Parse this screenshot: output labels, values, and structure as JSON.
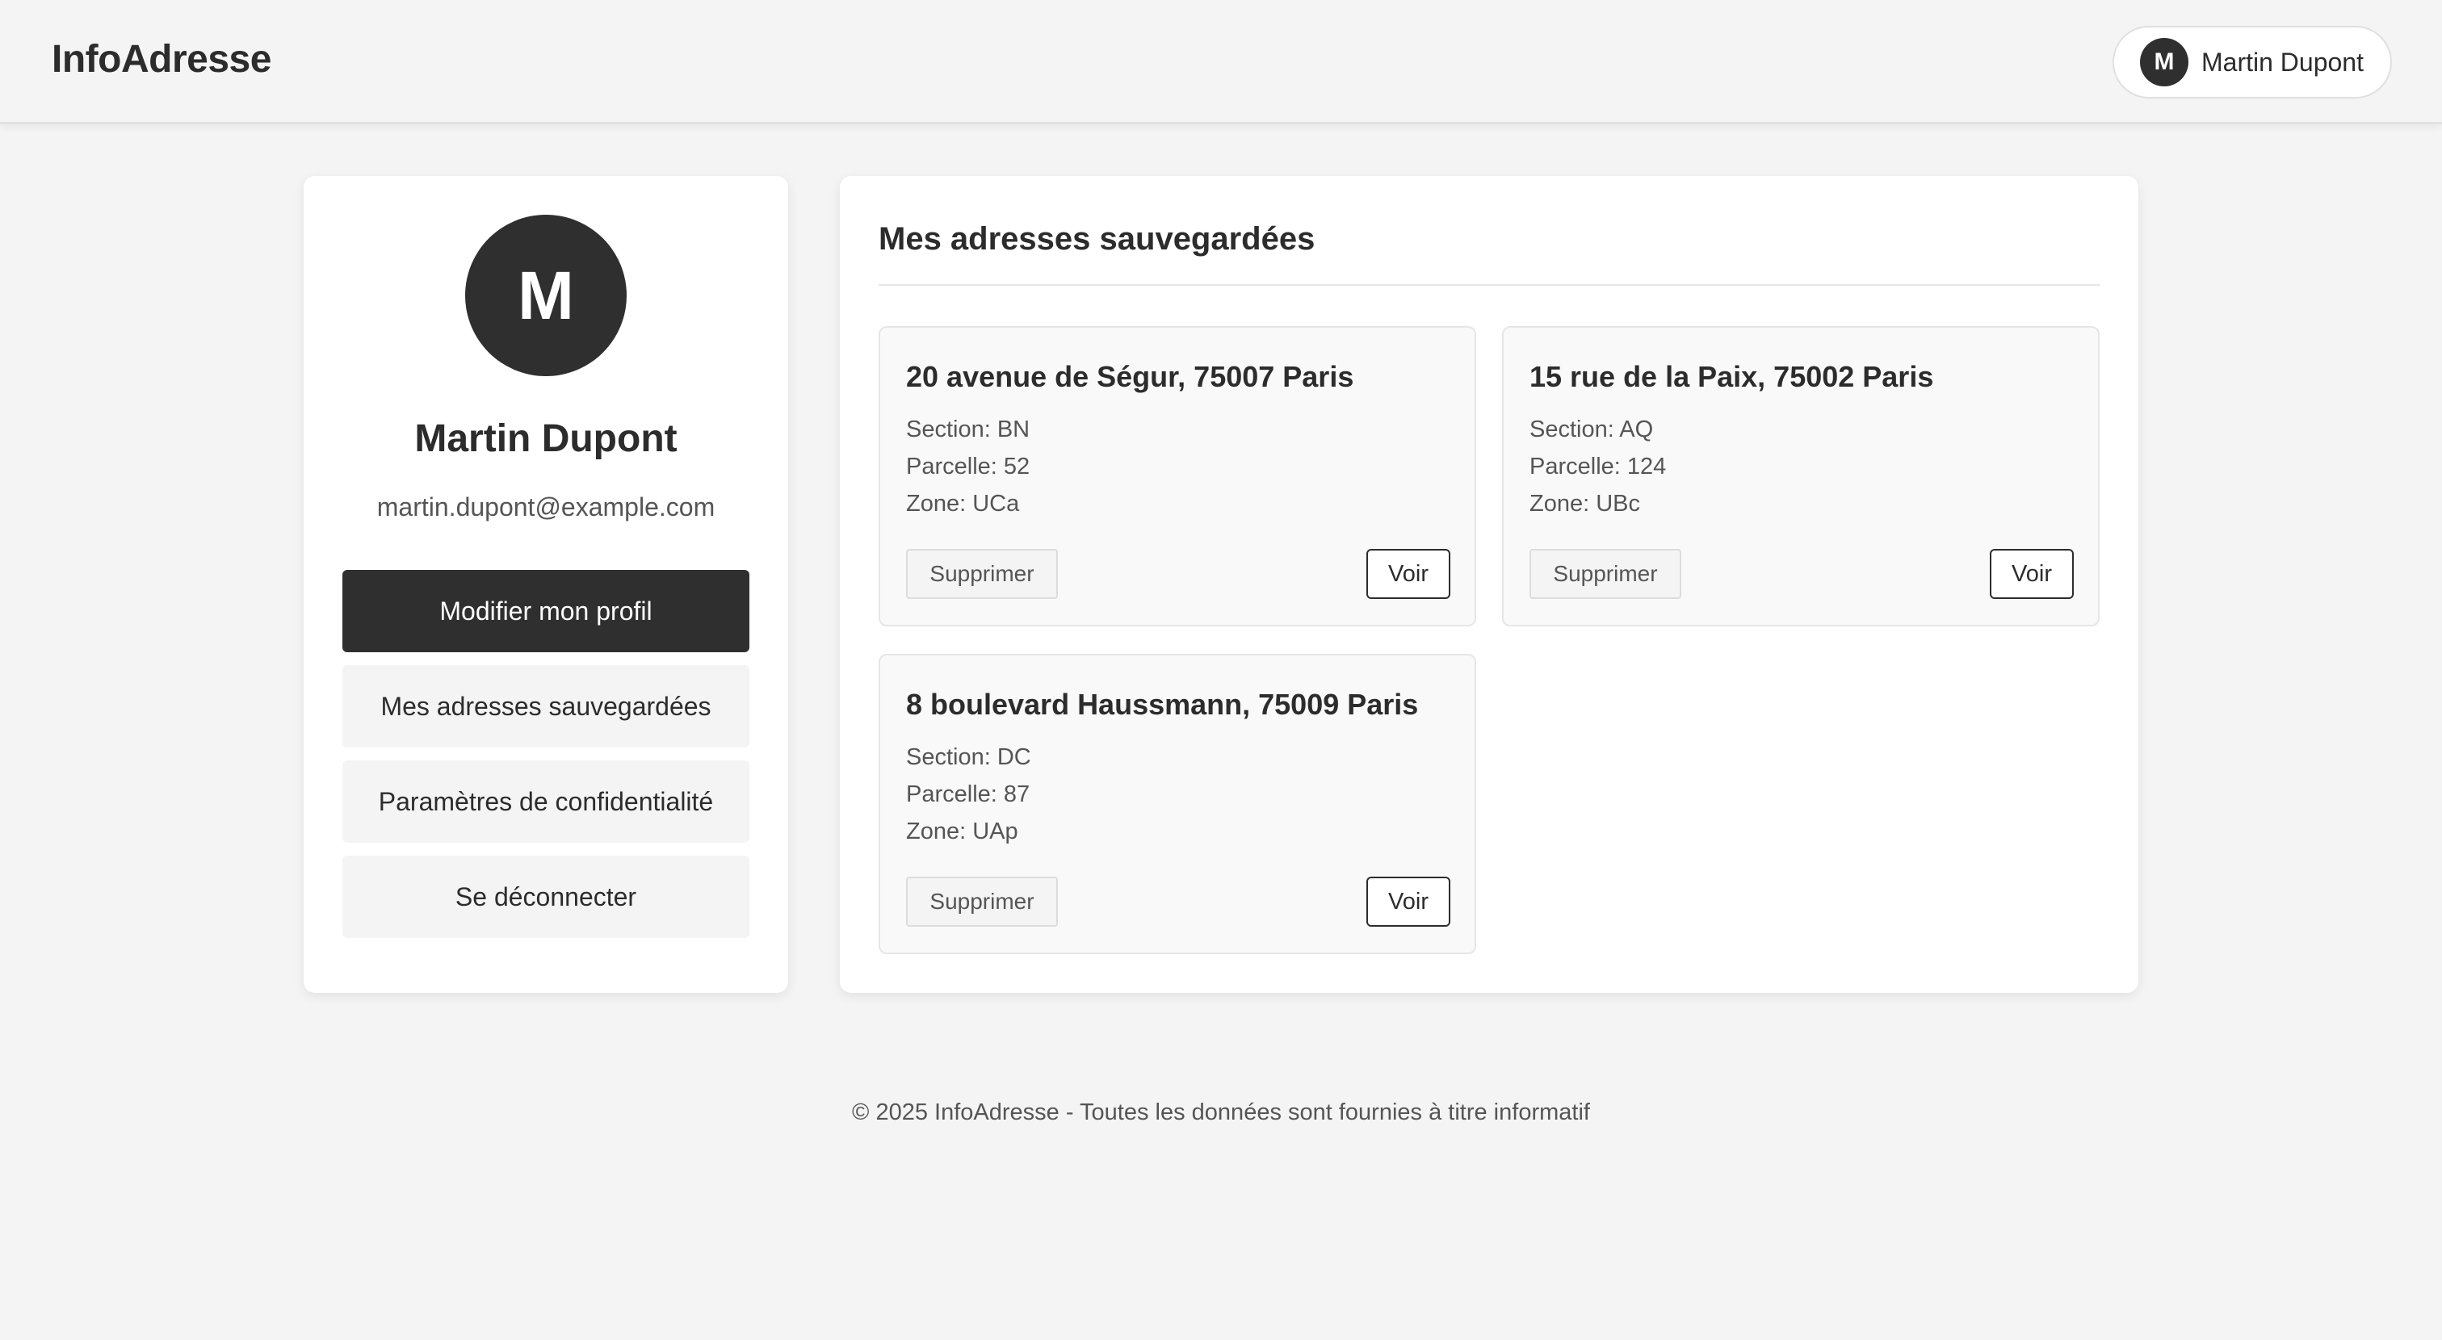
{
  "header": {
    "brand": "InfoAdresse",
    "user_chip": {
      "initial": "M",
      "name": "Martin Dupont"
    }
  },
  "profile": {
    "initial": "M",
    "name": "Martin Dupont",
    "email": "martin.dupont@example.com",
    "menu": [
      {
        "label": "Modifier mon profil"
      },
      {
        "label": "Mes adresses sauvegardées"
      },
      {
        "label": "Paramètres de confidentialité"
      },
      {
        "label": "Se déconnecter"
      }
    ]
  },
  "saved": {
    "title": "Mes adresses sauvegardées",
    "addresses": [
      {
        "title": "20 avenue de Ségur, 75007 Paris",
        "section": "Section: BN",
        "parcel": "Parcelle: 52",
        "zone": "Zone: UCa",
        "delete_label": "Supprimer",
        "view_label": "Voir"
      },
      {
        "title": "15 rue de la Paix, 75002 Paris",
        "section": "Section: AQ",
        "parcel": "Parcelle: 124",
        "zone": "Zone: UBc",
        "delete_label": "Supprimer",
        "view_label": "Voir"
      },
      {
        "title": "8 boulevard Haussmann, 75009 Paris",
        "section": "Section: DC",
        "parcel": "Parcelle: 87",
        "zone": "Zone: UAp",
        "delete_label": "Supprimer",
        "view_label": "Voir"
      }
    ]
  },
  "footer": {
    "text": "© 2025 InfoAdresse - Toutes les données sont fournies à titre informatif"
  },
  "colors": {
    "background": "#f4f4f4",
    "dark": "#2f2f2f",
    "card": "#ffffff",
    "text": "#2c2c2c",
    "muted": "#555555"
  }
}
